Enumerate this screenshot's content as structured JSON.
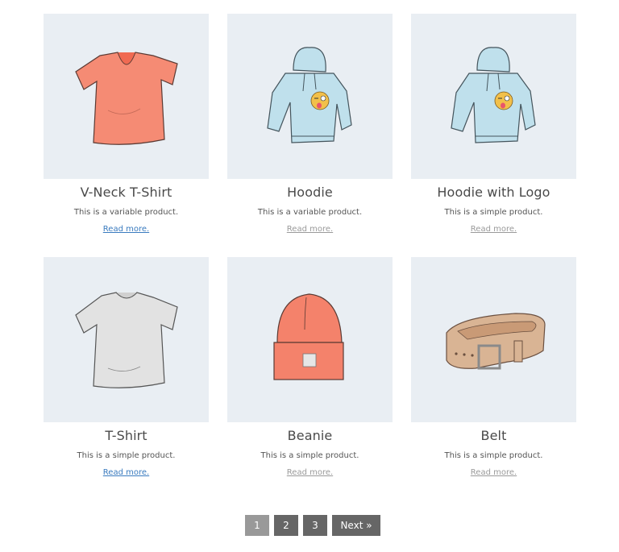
{
  "products": [
    {
      "name": "V-Neck T-Shirt",
      "description": "This is a variable product.",
      "link_label": "Read more.",
      "link_state": "unvisited",
      "image": "vneck-tshirt-image",
      "image_color": "#f4826b"
    },
    {
      "name": "Hoodie",
      "description": "This is a variable product.",
      "link_label": "Read more.",
      "link_state": "visited",
      "image": "hoodie-image",
      "image_color": "#bfe0ec"
    },
    {
      "name": "Hoodie with Logo",
      "description": "This is a simple product.",
      "link_label": "Read more.",
      "link_state": "visited",
      "image": "hoodie-with-logo-image",
      "image_color": "#bfe0ec"
    },
    {
      "name": "T-Shirt",
      "description": "This is a simple product.",
      "link_label": "Read more.",
      "link_state": "unvisited",
      "image": "tshirt-image",
      "image_color": "#dddddd"
    },
    {
      "name": "Beanie",
      "description": "This is a simple product.",
      "link_label": "Read more.",
      "link_state": "visited",
      "image": "beanie-image",
      "image_color": "#f4826b"
    },
    {
      "name": "Belt",
      "description": "This is a simple product.",
      "link_label": "Read more.",
      "link_state": "visited",
      "image": "belt-image",
      "image_color": "#d9b494"
    }
  ],
  "pagination": {
    "pages": [
      "1",
      "2",
      "3"
    ],
    "current": "1",
    "next_label": "Next »"
  },
  "colors": {
    "thumb_bg": "#e9eef3",
    "link_unvisited": "#3a7bbf",
    "link_visited": "#9a9a9a",
    "pager_bg": "#666666",
    "pager_current_bg": "#999999"
  }
}
